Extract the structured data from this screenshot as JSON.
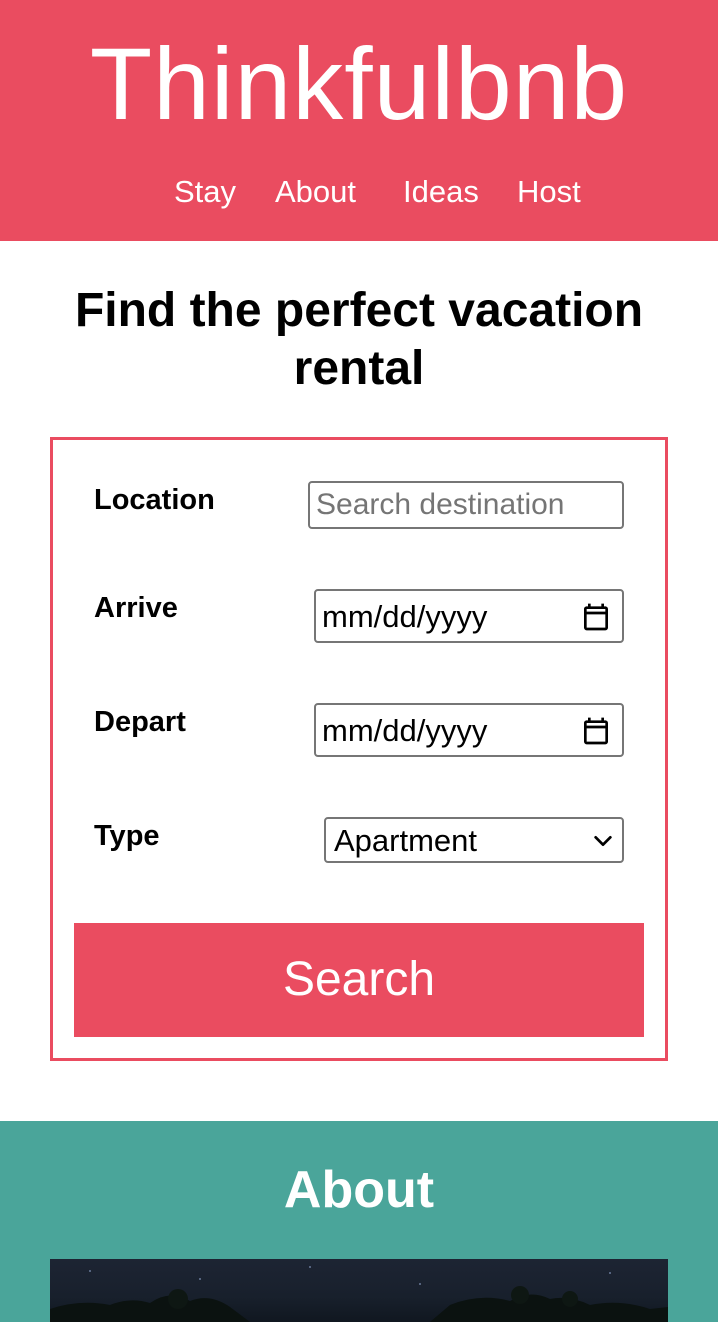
{
  "header": {
    "brand": "Thinkfulbnb",
    "nav": [
      "Stay",
      "About",
      "Ideas",
      "Host"
    ]
  },
  "main": {
    "headline": "Find the perfect vacation rental",
    "form": {
      "location_label": "Location",
      "location_placeholder": "Search destination",
      "arrive_label": "Arrive",
      "arrive_value": "mm/dd/yyyy",
      "depart_label": "Depart",
      "depart_value": "mm/dd/yyyy",
      "type_label": "Type",
      "type_selected": "Apartment",
      "search_label": "Search"
    }
  },
  "about": {
    "title": "About"
  },
  "colors": {
    "brand": "#ea4c60",
    "about_bg": "#4aa59a"
  },
  "icons": {
    "date_picker": "calendar-icon",
    "select": "chevron-down-icon"
  }
}
